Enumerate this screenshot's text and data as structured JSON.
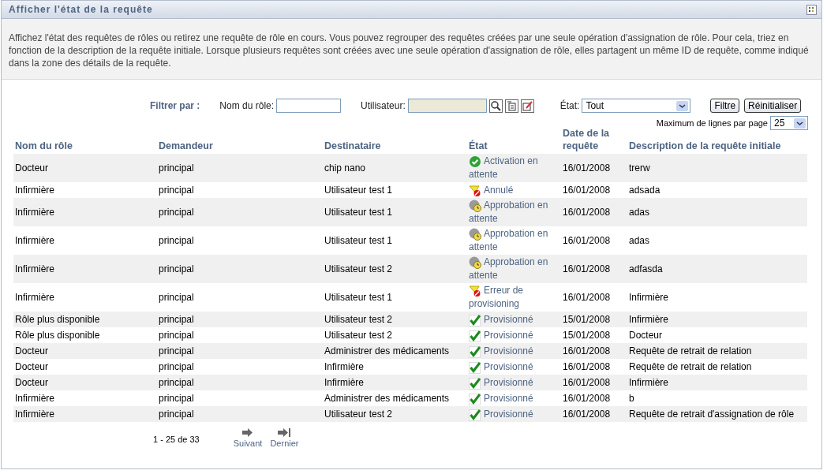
{
  "panel": {
    "title": "Afficher l'état de la requête",
    "description": "Affichez l'état des requêtes de rôles ou retirez une requête de rôle en cours. Vous pouvez regrouper des requêtes créées par une seule opération d'assignation de rôle. Pour cela, triez en fonction de la description de la requête initiale. Lorsque plusieurs requêtes sont créées avec une seule opération d'assignation de rôle, elles partagent un même ID de requête, comme indiqué dans la zone des détails de la requête."
  },
  "filter": {
    "label": "Filtrer par :",
    "role_label": "Nom du rôle:",
    "user_label": "Utilisateur:",
    "state_label": "État:",
    "state_value": "Tout",
    "filter_button": "Filtre",
    "reset_button": "Réinitialiser",
    "max_rows_label": "Maximum de lignes par page",
    "max_rows_value": "25"
  },
  "table": {
    "columns": [
      "Nom du rôle",
      "Demandeur",
      "Destinataire",
      "État",
      "Date de la requête",
      "Description de la requête initiale"
    ],
    "rows": [
      {
        "role": "Docteur",
        "requester": "principal",
        "recipient": "chip nano",
        "status": "Activation en attente",
        "kind": "activation",
        "date": "16/01/2008",
        "description": "trerw"
      },
      {
        "role": "Infirmière",
        "requester": "principal",
        "recipient": "Utilisateur test 1",
        "status": "Annulé",
        "kind": "error",
        "date": "16/01/2008",
        "description": "adsada"
      },
      {
        "role": "Infirmière",
        "requester": "principal",
        "recipient": "Utilisateur test 1",
        "status": "Approbation en attente",
        "kind": "pending",
        "date": "16/01/2008",
        "description": "adas"
      },
      {
        "role": "Infirmière",
        "requester": "principal",
        "recipient": "Utilisateur test 1",
        "status": "Approbation en attente",
        "kind": "pending",
        "date": "16/01/2008",
        "description": "adas"
      },
      {
        "role": "Infirmière",
        "requester": "principal",
        "recipient": "Utilisateur test 2",
        "status": "Approbation en attente",
        "kind": "pending",
        "date": "16/01/2008",
        "description": "adfasda"
      },
      {
        "role": "Infirmière",
        "requester": "principal",
        "recipient": "Utilisateur test 1",
        "status": "Erreur de provisioning",
        "kind": "error",
        "date": "16/01/2008",
        "description": "Infirmière"
      },
      {
        "role": "Rôle plus disponible",
        "requester": "principal",
        "recipient": "Utilisateur test 2",
        "status": "Provisionné",
        "kind": "done",
        "date": "15/01/2008",
        "description": "Infirmière"
      },
      {
        "role": "Rôle plus disponible",
        "requester": "principal",
        "recipient": "Utilisateur test 2",
        "status": "Provisionné",
        "kind": "done",
        "date": "15/01/2008",
        "description": "Docteur"
      },
      {
        "role": "Docteur",
        "requester": "principal",
        "recipient": "Administrer des médicaments",
        "status": "Provisionné",
        "kind": "done",
        "date": "16/01/2008",
        "description": "Requête de retrait de relation"
      },
      {
        "role": "Docteur",
        "requester": "principal",
        "recipient": "Infirmière",
        "status": "Provisionné",
        "kind": "done",
        "date": "16/01/2008",
        "description": "Requête de retrait de relation"
      },
      {
        "role": "Docteur",
        "requester": "principal",
        "recipient": "Infirmière",
        "status": "Provisionné",
        "kind": "done",
        "date": "16/01/2008",
        "description": "Infirmière"
      },
      {
        "role": "Infirmière",
        "requester": "principal",
        "recipient": "Administrer des médicaments",
        "status": "Provisionné",
        "kind": "done",
        "date": "16/01/2008",
        "description": "b"
      },
      {
        "role": "Infirmière",
        "requester": "principal",
        "recipient": "Utilisateur test 2",
        "status": "Provisionné",
        "kind": "done",
        "date": "16/01/2008",
        "description": "Requête de retrait d'assignation de rôle"
      }
    ]
  },
  "pagination": {
    "range": "1 - 25 de 33",
    "next": "Suivant",
    "last": "Dernier"
  }
}
